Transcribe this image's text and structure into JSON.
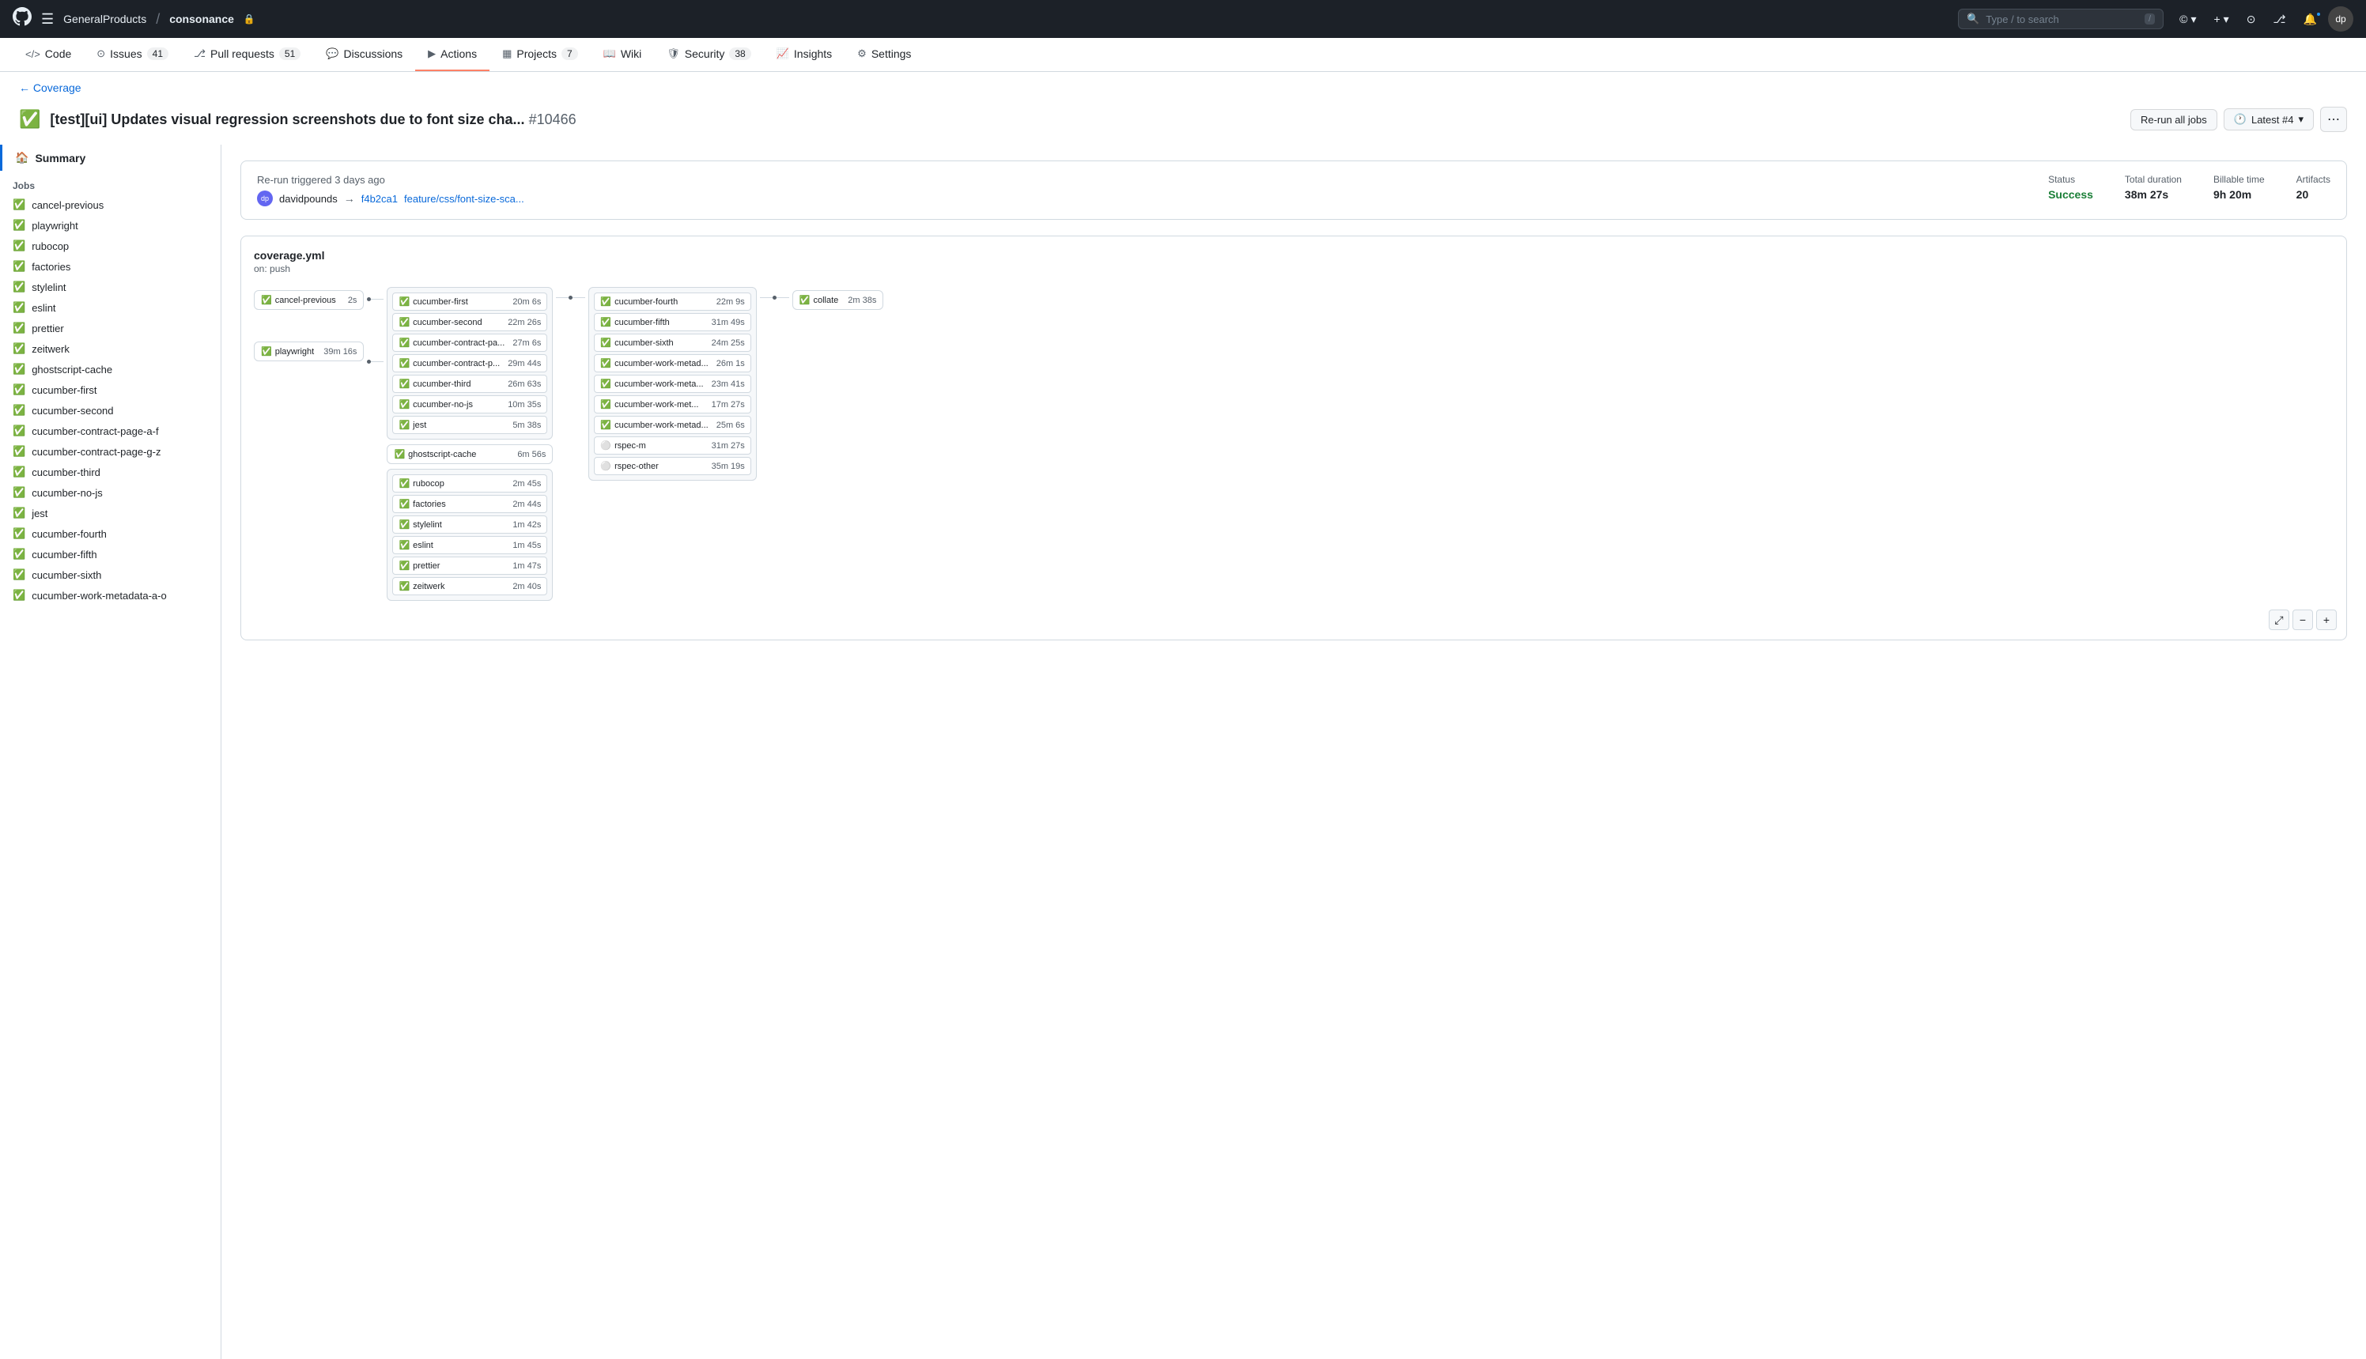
{
  "topnav": {
    "org": "GeneralProducts",
    "sep": "/",
    "repo": "consonance",
    "lock_icon": "🔒",
    "search_placeholder": "Type / to search",
    "search_shortcut": "/",
    "copilot_icon": "©",
    "plus_icon": "+",
    "issues_icon": "⊙",
    "pr_icon": "⎇",
    "bell_icon": "🔔"
  },
  "repo_tabs": [
    {
      "id": "code",
      "icon": "</>",
      "label": "Code",
      "count": null
    },
    {
      "id": "issues",
      "icon": "⊙",
      "label": "Issues",
      "count": "41"
    },
    {
      "id": "pull_requests",
      "icon": "⎇",
      "label": "Pull requests",
      "count": "51"
    },
    {
      "id": "discussions",
      "icon": "💬",
      "label": "Discussions",
      "count": null
    },
    {
      "id": "actions",
      "icon": "▶",
      "label": "Actions",
      "count": null,
      "active": true
    },
    {
      "id": "projects",
      "icon": "▦",
      "label": "Projects",
      "count": "7"
    },
    {
      "id": "wiki",
      "icon": "📖",
      "label": "Wiki",
      "count": null
    },
    {
      "id": "security",
      "icon": "🛡",
      "label": "Security",
      "count": "38"
    },
    {
      "id": "insights",
      "icon": "📊",
      "label": "Insights",
      "count": null
    },
    {
      "id": "settings",
      "icon": "⚙",
      "label": "Settings",
      "count": null
    }
  ],
  "breadcrumb": {
    "back_label": "← Coverage"
  },
  "page_header": {
    "status_icon": "✅",
    "title": "[test][ui] Updates visual regression screenshots due to font size cha...",
    "run_number": "#10466",
    "btn_rerun": "Re-run all jobs",
    "btn_latest": "Latest #4",
    "btn_dots": "..."
  },
  "sidebar": {
    "summary_label": "Summary",
    "jobs_label": "Jobs",
    "jobs": [
      "cancel-previous",
      "playwright",
      "rubocop",
      "factories",
      "stylelint",
      "eslint",
      "prettier",
      "zeitwerk",
      "ghostscript-cache",
      "cucumber-first",
      "cucumber-second",
      "cucumber-contract-page-a-f",
      "cucumber-contract-page-g-z",
      "cucumber-third",
      "cucumber-no-js",
      "jest",
      "cucumber-fourth",
      "cucumber-fifth",
      "cucumber-sixth",
      "cucumber-work-metadata-a-o"
    ]
  },
  "status_bar": {
    "trigger_label": "Re-run triggered 3 days ago",
    "user_avatar": "dp",
    "user": "davidpounds",
    "commit": "f4b2ca1",
    "branch": "feature/css/font-size-sca...",
    "status_label": "Status",
    "status_value": "Success",
    "duration_label": "Total duration",
    "duration_value": "38m 27s",
    "billable_label": "Billable time",
    "billable_value": "9h 20m",
    "artifacts_label": "Artifacts",
    "artifacts_value": "20"
  },
  "workflow": {
    "title": "coverage.yml",
    "trigger": "on: push",
    "nodes": {
      "col1": [
        {
          "name": "cancel-previous",
          "time": "2s",
          "check": "green"
        },
        {
          "name": "playwright",
          "time": "39m 16s",
          "check": "green"
        }
      ],
      "col2_top": [
        {
          "name": "cucumber-first",
          "time": "20m 6s",
          "check": "green"
        },
        {
          "name": "cucumber-second",
          "time": "22m 26s",
          "check": "green"
        },
        {
          "name": "cucumber-contract-pa...",
          "time": "27m 6s",
          "check": "green"
        },
        {
          "name": "cucumber-contract-p...",
          "time": "29m 44s",
          "check": "green"
        },
        {
          "name": "cucumber-third",
          "time": "26m 63s",
          "check": "green"
        },
        {
          "name": "cucumber-no-js",
          "time": "10m 35s",
          "check": "green"
        },
        {
          "name": "jest",
          "time": "5m 38s",
          "check": "green"
        }
      ],
      "col2_ghostscript": [
        {
          "name": "ghostscript-cache",
          "time": "6m 56s",
          "check": "green"
        }
      ],
      "col2_bottom": [
        {
          "name": "rubocop",
          "time": "2m 45s",
          "check": "green"
        },
        {
          "name": "factories",
          "time": "2m 44s",
          "check": "green"
        },
        {
          "name": "stylelint",
          "time": "1m 42s",
          "check": "green"
        },
        {
          "name": "eslint",
          "time": "1m 45s",
          "check": "green"
        },
        {
          "name": "prettier",
          "time": "1m 47s",
          "check": "green"
        },
        {
          "name": "zeitwerk",
          "time": "2m 40s",
          "check": "green"
        }
      ],
      "col3": [
        {
          "name": "cucumber-fourth",
          "time": "22m 9s",
          "check": "green"
        },
        {
          "name": "cucumber-fifth",
          "time": "31m 49s",
          "check": "green"
        },
        {
          "name": "cucumber-sixth",
          "time": "24m 25s",
          "check": "green"
        },
        {
          "name": "cucumber-work-metad...",
          "time": "26m 1s",
          "check": "green"
        },
        {
          "name": "cucumber-work-meta...",
          "time": "23m 41s",
          "check": "green"
        },
        {
          "name": "cucumber-work-met...",
          "time": "17m 27s",
          "check": "green"
        },
        {
          "name": "cucumber-work-metad...",
          "time": "25m 6s",
          "check": "green"
        },
        {
          "name": "rspec-m",
          "time": "31m 27s",
          "check": "gray"
        },
        {
          "name": "rspec-other",
          "time": "35m 19s",
          "check": "gray"
        }
      ],
      "col4": [
        {
          "name": "collate",
          "time": "2m 38s",
          "check": "green"
        }
      ]
    }
  }
}
